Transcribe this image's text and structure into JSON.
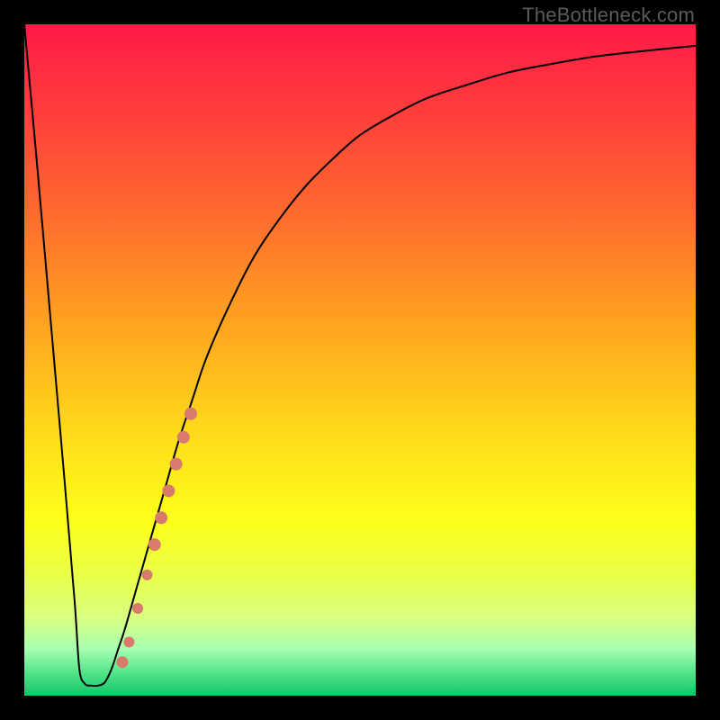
{
  "watermark": "TheBottleneck.com",
  "colors": {
    "frame": "#000000",
    "curve": "#000000",
    "markers": "#d87b6d",
    "gradient_stops": [
      {
        "offset": 0.0,
        "color": "#ff1a47"
      },
      {
        "offset": 0.12,
        "color": "#ff3a3d"
      },
      {
        "offset": 0.28,
        "color": "#ff6a2f"
      },
      {
        "offset": 0.45,
        "color": "#ffa51f"
      },
      {
        "offset": 0.62,
        "color": "#ffde1a"
      },
      {
        "offset": 0.74,
        "color": "#fdff1a"
      },
      {
        "offset": 0.82,
        "color": "#eaff47"
      },
      {
        "offset": 0.885,
        "color": "#d8ff82"
      },
      {
        "offset": 0.93,
        "color": "#a8ffb0"
      },
      {
        "offset": 0.965,
        "color": "#55e58a"
      },
      {
        "offset": 1.0,
        "color": "#11c569"
      }
    ]
  },
  "chart_data": {
    "type": "line",
    "title": "",
    "xlabel": "",
    "ylabel": "",
    "xlim": [
      0,
      100
    ],
    "ylim": [
      0,
      100
    ],
    "series": [
      {
        "name": "bottleneck-curve",
        "x": [
          0,
          2,
          4,
          6,
          7.5,
          8.2,
          9,
          10,
          11,
          12,
          13,
          14,
          15,
          17,
          19,
          21,
          23,
          25,
          27,
          30,
          34,
          38,
          42,
          46,
          50,
          55,
          60,
          66,
          72,
          78,
          85,
          92,
          100
        ],
        "y": [
          100,
          78,
          55,
          32,
          14,
          4,
          1.8,
          1.5,
          1.5,
          2,
          4,
          7,
          10,
          17,
          24,
          31,
          38,
          44,
          50,
          57,
          65,
          71,
          76,
          80,
          83.5,
          86.5,
          89,
          91,
          92.8,
          94,
          95.2,
          96,
          96.8
        ]
      }
    ],
    "markers": {
      "name": "highlight-segment",
      "points": [
        {
          "x": 14.6,
          "y": 5.0,
          "r": 6.5
        },
        {
          "x": 15.6,
          "y": 8.0,
          "r": 6.0
        },
        {
          "x": 16.9,
          "y": 13.0,
          "r": 6.0
        },
        {
          "x": 18.3,
          "y": 18.0,
          "r": 6.0
        },
        {
          "x": 19.4,
          "y": 22.5,
          "r": 7.0
        },
        {
          "x": 20.4,
          "y": 26.5,
          "r": 7.0
        },
        {
          "x": 21.5,
          "y": 30.5,
          "r": 7.0
        },
        {
          "x": 22.6,
          "y": 34.5,
          "r": 7.0
        },
        {
          "x": 23.7,
          "y": 38.5,
          "r": 7.0
        },
        {
          "x": 24.8,
          "y": 42.0,
          "r": 7.0
        }
      ]
    }
  }
}
